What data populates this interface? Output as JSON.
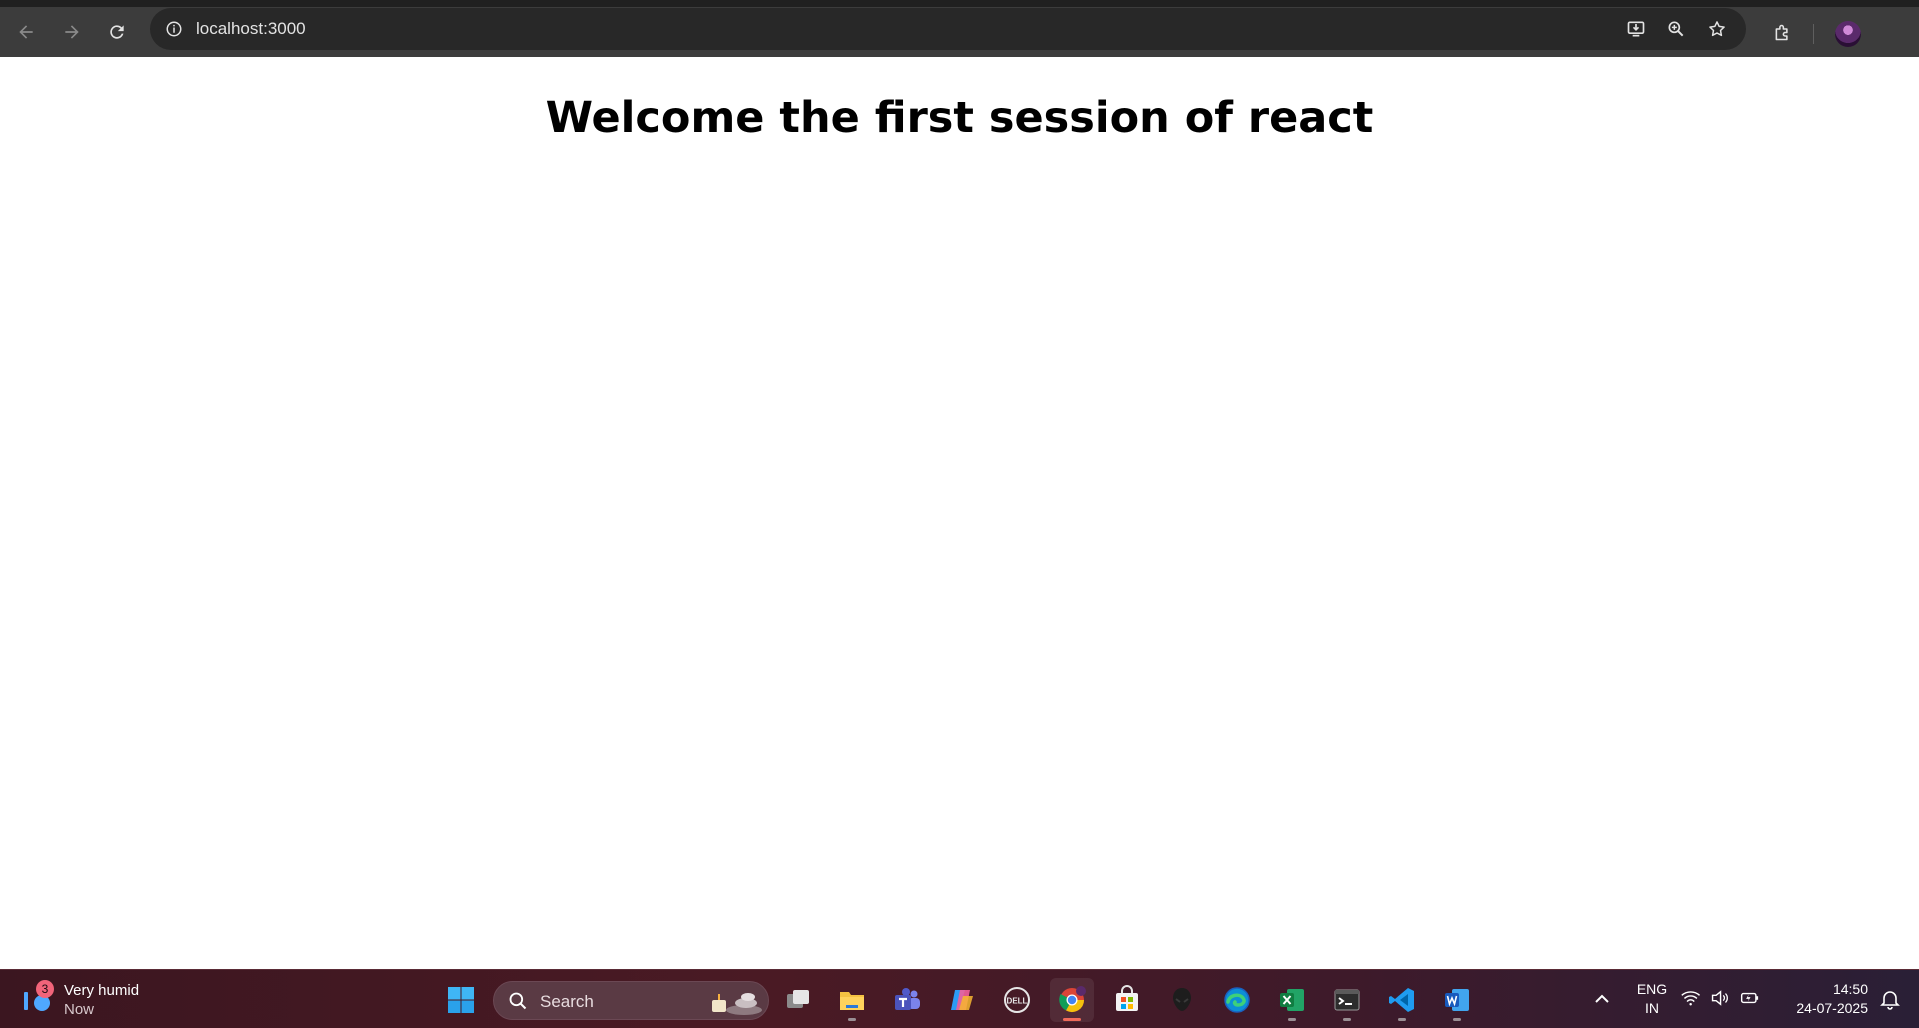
{
  "browser": {
    "url": "localhost:3000",
    "icons": {
      "back": "arrow-left-icon",
      "forward": "arrow-right-icon",
      "reload": "reload-icon",
      "site_info": "info-icon",
      "install": "install-app-icon",
      "zoom": "zoom-icon",
      "bookmark": "star-icon",
      "extensions": "puzzle-icon"
    }
  },
  "page": {
    "heading": "Welcome the first session of react"
  },
  "taskbar": {
    "weather": {
      "badge": "3",
      "title": "Very humid",
      "subtitle": "Now"
    },
    "search_label": "Search",
    "apps": [
      "start",
      "task-view",
      "file-explorer",
      "teams",
      "copilot",
      "dell",
      "chrome",
      "store",
      "alienware",
      "edge",
      "excel",
      "terminal",
      "vscode",
      "word"
    ],
    "lang_top": "ENG",
    "lang_bottom": "IN",
    "time": "14:50",
    "date": "24-07-2025"
  },
  "colors": {
    "chrome_bg": "#3c3c3c",
    "omnibox_bg": "#282828",
    "taskbar_accent": "#4a1a24",
    "active_indicator": "#f06a5a"
  }
}
